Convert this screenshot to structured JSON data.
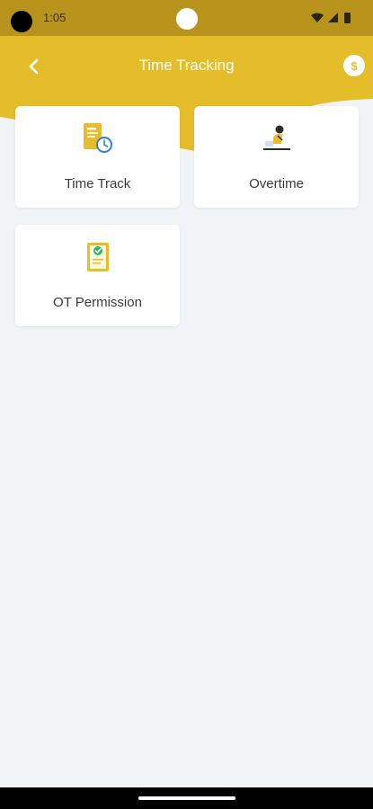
{
  "status_bar": {
    "time": "1:05"
  },
  "header": {
    "title": "Time Tracking",
    "coin_symbol": "$"
  },
  "colors": {
    "accent": "#e5bd2a",
    "status_bar": "#b8941d",
    "background": "#f0f4f7",
    "check": "#2fb36a",
    "clock": "#2f7fd9"
  },
  "cards": [
    {
      "label": "Time Track",
      "icon": "document-clock-icon"
    },
    {
      "label": "Overtime",
      "icon": "person-at-desk-icon"
    },
    {
      "label": "OT Permission",
      "icon": "approved-document-icon"
    }
  ]
}
